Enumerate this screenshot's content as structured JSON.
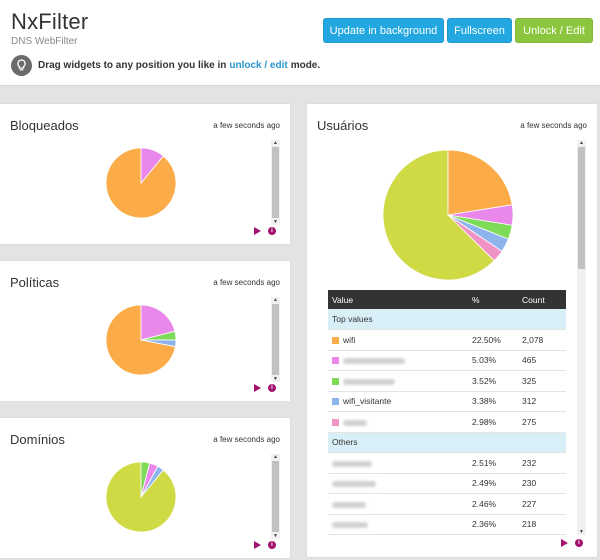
{
  "header": {
    "title": "NxFilter",
    "subtitle": "DNS WebFilter",
    "hint_before": "Drag widgets to any position you like in",
    "hint_link": "unlock / edit",
    "hint_after": "mode.",
    "buttons": {
      "update": "Update in background",
      "fullscreen": "Fullscreen",
      "unlock": "Unlock / Edit"
    }
  },
  "colors": {
    "blue_button": "#22a7e0",
    "green_button": "#8cc63e",
    "accent_icon": "#a3126f",
    "orange": "#fbac48",
    "pink": "#ea87ea",
    "green": "#7edb58",
    "blue": "#8eb4ee",
    "rose": "#ef93c4",
    "lime": "#cfda44"
  },
  "widgets": {
    "bloqueados": {
      "title": "Bloqueados",
      "time": "a few seconds ago"
    },
    "politicas": {
      "title": "Políticas",
      "time": "a few seconds ago"
    },
    "dominios": {
      "title": "Domínios",
      "time": "a few seconds ago"
    },
    "usuarios": {
      "title": "Usuários",
      "time": "a few seconds ago"
    }
  },
  "table": {
    "headers": {
      "value": "Value",
      "percent": "%",
      "count": "Count"
    },
    "top_group": "Top values",
    "others_group": "Others",
    "top": [
      {
        "value": "wifi",
        "percent": "22.50%",
        "count": "2,078",
        "color": "#fbac48"
      },
      {
        "value": "",
        "percent": "5.03%",
        "count": "465",
        "color": "#ea87ea"
      },
      {
        "value": "",
        "percent": "3.52%",
        "count": "325",
        "color": "#7edb58"
      },
      {
        "value": "wifi_visitante",
        "percent": "3.38%",
        "count": "312",
        "color": "#8eb4ee"
      },
      {
        "value": "",
        "percent": "2.98%",
        "count": "275",
        "color": "#ef93c4"
      }
    ],
    "others": [
      {
        "value": "",
        "percent": "2.51%",
        "count": "232"
      },
      {
        "value": "",
        "percent": "2.49%",
        "count": "230"
      },
      {
        "value": "",
        "percent": "2.46%",
        "count": "227"
      },
      {
        "value": "",
        "percent": "2.36%",
        "count": "218"
      }
    ]
  },
  "pies": {
    "bloqueados": [
      {
        "color": "#fbac48",
        "value": 89
      },
      {
        "color": "#ea87ea",
        "value": 11
      }
    ],
    "politicas": [
      {
        "color": "#fbac48",
        "value": 72
      },
      {
        "color": "#ea87ea",
        "value": 21
      },
      {
        "color": "#7edb58",
        "value": 4
      },
      {
        "color": "#8eb4ee",
        "value": 3
      }
    ],
    "dominios": [
      {
        "color": "#cfda44",
        "value": 89
      },
      {
        "color": "#7edb58",
        "value": 4
      },
      {
        "color": "#ea87ea",
        "value": 4
      },
      {
        "color": "#8eb4ee",
        "value": 3
      }
    ],
    "usuarios": [
      {
        "color": "#cfda44",
        "value": 62.6
      },
      {
        "color": "#fbac48",
        "value": 22.5
      },
      {
        "color": "#ea87ea",
        "value": 5.03
      },
      {
        "color": "#7edb58",
        "value": 3.52
      },
      {
        "color": "#8eb4ee",
        "value": 3.38
      },
      {
        "color": "#ef93c4",
        "value": 2.98
      }
    ]
  }
}
